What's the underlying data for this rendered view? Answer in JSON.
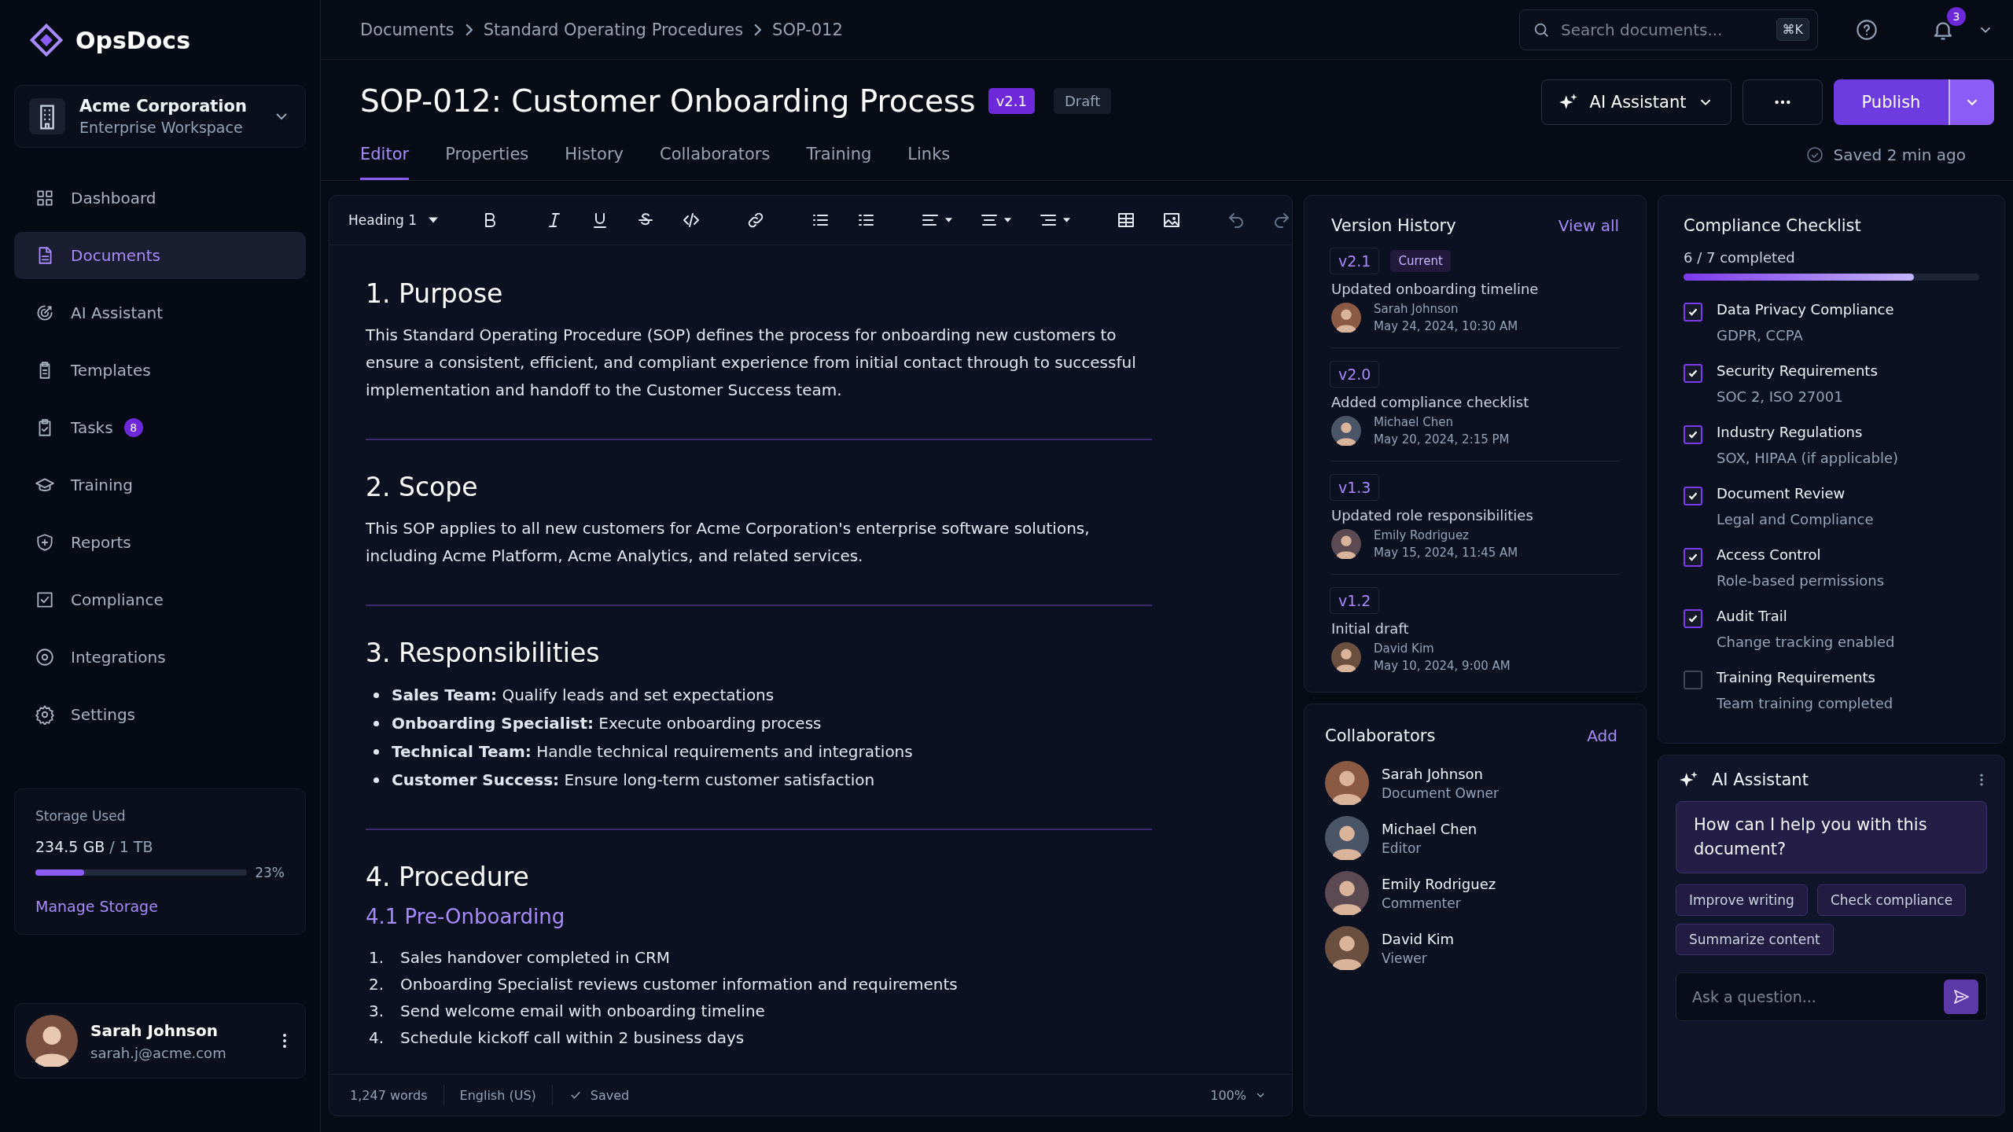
{
  "app": {
    "name": "OpsDocs"
  },
  "workspace": {
    "name": "Acme Corporation",
    "plan": "Enterprise Workspace"
  },
  "nav": [
    {
      "label": "Dashboard",
      "selected": false
    },
    {
      "label": "Documents",
      "selected": true
    },
    {
      "label": "AI Assistant",
      "selected": false
    },
    {
      "label": "Templates",
      "selected": false
    },
    {
      "label": "Tasks",
      "selected": false,
      "badge": "8"
    },
    {
      "label": "Training",
      "selected": false
    },
    {
      "label": "Reports",
      "selected": false
    },
    {
      "label": "Compliance",
      "selected": false
    },
    {
      "label": "Integrations",
      "selected": false
    },
    {
      "label": "Settings",
      "selected": false
    }
  ],
  "storage": {
    "title": "Storage Used",
    "used": "234.5 GB",
    "total": "/ 1 TB",
    "level": 0.23,
    "percent": "23%",
    "link": "Manage Storage"
  },
  "user": {
    "name": "Sarah Johnson",
    "email": "sarah.j@acme.com"
  },
  "breadcrumbs": [
    "Documents",
    "Standard Operating Procedures",
    "SOP-012"
  ],
  "search": {
    "placeholder": "Search documents...",
    "shortcut": "⌘K"
  },
  "notifications": {
    "count": "3"
  },
  "document": {
    "title": "SOP-012: Customer Onboarding Process",
    "version": "v2.1",
    "status": "Draft"
  },
  "actions": {
    "ai": "AI Assistant",
    "publish": "Publish"
  },
  "tabs": [
    {
      "label": "Editor",
      "selected": true
    },
    {
      "label": "Properties",
      "selected": false
    },
    {
      "label": "History",
      "selected": false
    },
    {
      "label": "Collaborators",
      "selected": false
    },
    {
      "label": "Training",
      "selected": false
    },
    {
      "label": "Links",
      "selected": false
    }
  ],
  "save_status": "Saved 2 min ago",
  "toolbar": {
    "style": "Heading 1"
  },
  "content": [
    {
      "kind": "heading",
      "text": "1. Purpose"
    },
    {
      "kind": "paragraph",
      "text": "This Standard Operating Procedure (SOP) defines the process for onboarding new customers to ensure a consistent, efficient, and compliant experience from initial contact through to successful implementation and handoff to the Customer Success team."
    },
    {
      "kind": "divider"
    },
    {
      "kind": "heading",
      "text": "2. Scope"
    },
    {
      "kind": "paragraph",
      "text": "This SOP applies to all new customers for Acme Corporation's enterprise software solutions, including Acme Platform, Acme Analytics, and related services."
    },
    {
      "kind": "divider"
    },
    {
      "kind": "heading",
      "text": "3. Responsibilities"
    },
    {
      "kind": "bullets",
      "items": [
        "**Sales Team:** Qualify leads and set expectations",
        "**Onboarding Specialist:** Execute onboarding process",
        "**Technical Team:** Handle technical requirements and integrations",
        "**Customer Success:** Ensure long-term customer satisfaction"
      ]
    },
    {
      "kind": "divider"
    },
    {
      "kind": "heading",
      "text": "4. Procedure"
    },
    {
      "kind": "subheading",
      "text": "4.1 Pre-Onboarding"
    },
    {
      "kind": "numbered",
      "items": [
        {
          "marker": "1.",
          "text": "Sales handover completed in CRM"
        },
        {
          "marker": "2.",
          "text": "Onboarding Specialist reviews customer information and requirements"
        },
        {
          "marker": "3.",
          "text": "Send welcome email with onboarding timeline"
        },
        {
          "marker": "4.",
          "text": "Schedule kickoff call within 2 business days"
        }
      ]
    }
  ],
  "status_bar": {
    "words": "1,247 words",
    "language": "English (US)",
    "saved": "Saved",
    "zoom": "100%"
  },
  "version_history": {
    "title": "Version History",
    "link": "View all",
    "versions": [
      {
        "version": "v2.1",
        "badge": "Current",
        "summary": "Updated onboarding timeline",
        "author": "Sarah Johnson",
        "date": "May 24, 2024, 10:30 AM"
      },
      {
        "version": "v2.0",
        "summary": "Added compliance checklist",
        "author": "Michael Chen",
        "date": "May 20, 2024, 2:15 PM"
      },
      {
        "version": "v1.3",
        "summary": "Updated role responsibilities",
        "author": "Emily Rodriguez",
        "date": "May 15, 2024, 11:45 AM"
      },
      {
        "version": "v1.2",
        "summary": "Initial draft",
        "author": "David Kim",
        "date": "May 10, 2024, 9:00 AM"
      }
    ]
  },
  "collaborators": {
    "title": "Collaborators",
    "link": "Add",
    "people": [
      {
        "name": "Sarah Johnson",
        "role": "Document Owner"
      },
      {
        "name": "Michael Chen",
        "role": "Editor"
      },
      {
        "name": "Emily Rodriguez",
        "role": "Commenter"
      },
      {
        "name": "David Kim",
        "role": "Viewer"
      }
    ]
  },
  "compliance": {
    "title": "Compliance Checklist",
    "progress": "6 / 7 completed",
    "level": 0.78,
    "items": [
      {
        "label": "Data Privacy Compliance",
        "detail": "GDPR, CCPA",
        "checked": true
      },
      {
        "label": "Security Requirements",
        "detail": "SOC 2, ISO 27001",
        "checked": true
      },
      {
        "label": "Industry Regulations",
        "detail": "SOX, HIPAA (if applicable)",
        "checked": true
      },
      {
        "label": "Document Review",
        "detail": "Legal and Compliance",
        "checked": true
      },
      {
        "label": "Access Control",
        "detail": "Role-based permissions",
        "checked": true
      },
      {
        "label": "Audit Trail",
        "detail": "Change tracking enabled",
        "checked": true
      },
      {
        "label": "Training Requirements",
        "detail": "Team training completed",
        "checked": false
      }
    ]
  },
  "assistant": {
    "title": "AI Assistant",
    "message": "How can I help you with this document?",
    "suggestions": [
      "Improve writing",
      "Check compliance",
      "Summarize content"
    ],
    "input": {
      "placeholder": "Ask a question..."
    }
  }
}
